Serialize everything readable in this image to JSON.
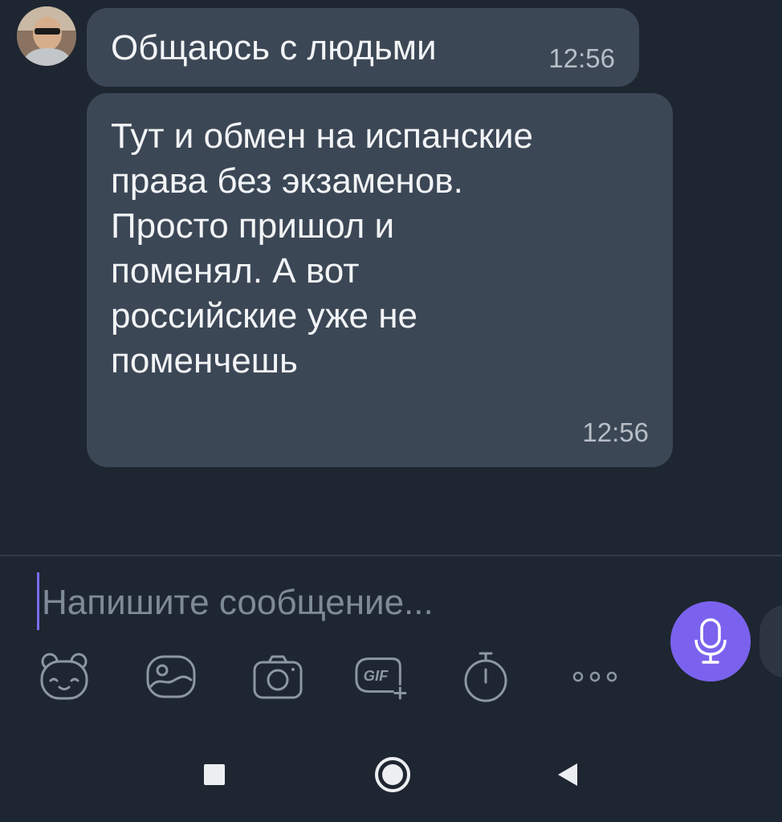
{
  "messages": [
    {
      "text": "Общаюсь с людьми",
      "time": "12:56"
    },
    {
      "text": "Тут и обмен на испанские\nправа без экзаменов.\nПросто пришол и\nпоменял. А вот\nроссийские уже не\nпоменчешь",
      "time": "12:56"
    }
  ],
  "composer": {
    "placeholder": "Напишите сообщение...",
    "value": ""
  },
  "toolbar": {
    "items": [
      "sticker-icon",
      "gallery-icon",
      "camera-icon",
      "gif-icon",
      "timer-icon",
      "more-icon"
    ],
    "gif_label": "GIF"
  },
  "navigation": [
    "recent-apps-icon",
    "home-icon",
    "back-icon"
  ],
  "colors": {
    "background": "#1e2631",
    "bubble": "#3c4756",
    "accent": "#7b62ee",
    "icon": "#8c97a3"
  }
}
